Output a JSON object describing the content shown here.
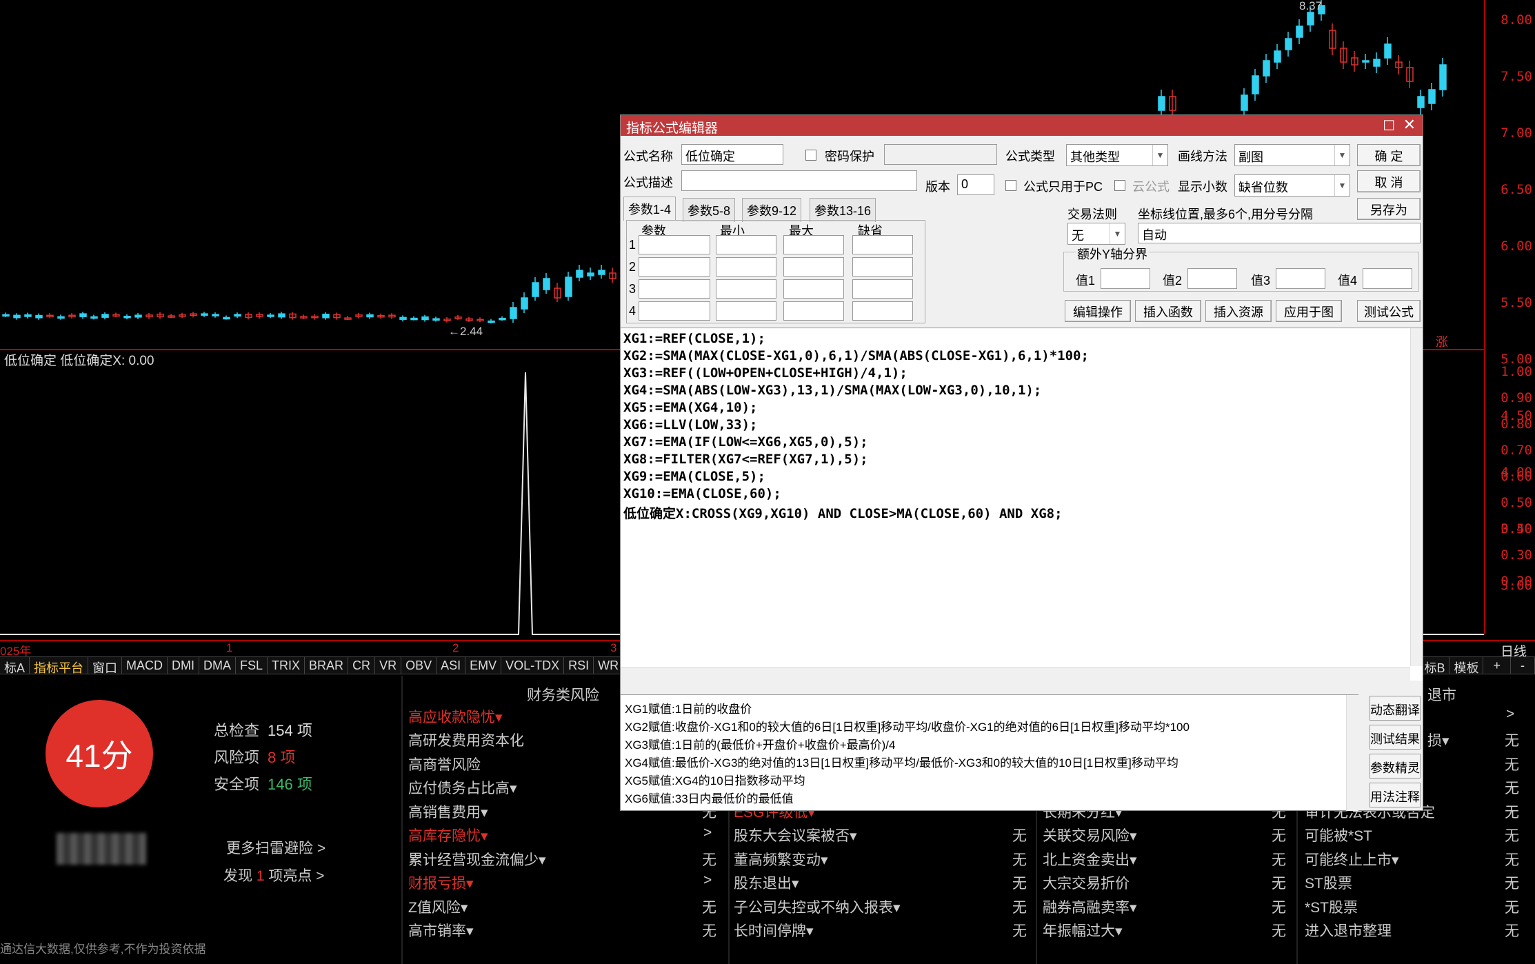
{
  "price_chart": {
    "high_label": "8.37",
    "low_label": "2.44",
    "y_ticks": [
      "8.00",
      "7.50",
      "7.00",
      "6.50",
      "6.00",
      "5.50",
      "5.00",
      "4.50",
      "4.00",
      "3.50",
      "3.00"
    ],
    "zhang_label": "涨"
  },
  "indicator": {
    "title": "低位确定  低位确定X: 0.00",
    "y_ticks": [
      "1.00",
      "0.90",
      "0.80",
      "0.70",
      "0.60",
      "0.50",
      "0.40",
      "0.30",
      "0.20"
    ]
  },
  "date_axis": {
    "labels": [
      "025年",
      "1",
      "2",
      "3"
    ],
    "period": "日线"
  },
  "tabs": [
    "标A",
    "指标平台",
    "窗口",
    "MACD",
    "DMI",
    "DMA",
    "FSL",
    "TRIX",
    "BRAR",
    "CR",
    "VR",
    "OBV",
    "ASI",
    "EMV",
    "VOL-TDX",
    "RSI",
    "WR"
  ],
  "tabs_right": [
    "标B",
    "模板",
    "+",
    "-"
  ],
  "risk": {
    "score": "41分",
    "total_label": "总检查",
    "total_value": "154 项",
    "risk_label": "风险项",
    "risk_value": "8 项",
    "safe_label": "安全项",
    "safe_value": "146 项",
    "more_scan": "更多扫雷避险 >",
    "found_prefix": "发现",
    "found_count": "1",
    "found_suffix": "项亮点 >",
    "disclaimer": "通达信大数据,仅供参考,不作为投资依据",
    "fin_title": "财务类风险",
    "col1": [
      "高应收款隐忧▾",
      "高研发费用资本化",
      "高商誉风险",
      "应付债务占比高▾",
      "高销售费用▾",
      "高库存隐忧▾",
      "累计经营现金流偏少▾",
      "财报亏损▾",
      "Z值风险▾",
      "高市销率▾"
    ],
    "col1_vals": [
      "",
      "",
      "",
      "",
      "无",
      ">",
      "无",
      ">",
      "无",
      "无"
    ],
    "col2": [
      "ESG评级低▾",
      "股东大会议案被否▾",
      "董高频繁变动▾",
      "股东退出▾",
      "子公司失控或不纳入报表▾",
      "长时间停牌▾"
    ],
    "col2_vals": [
      ">",
      "无",
      "无",
      "无",
      "无",
      "无"
    ],
    "col3": [
      "长期未分红▾",
      "关联交易风险▾",
      "北上资金卖出▾",
      "大宗交易折价",
      "融券高融卖率▾",
      "年振幅过大▾"
    ],
    "col3_vals": [
      "无",
      "无",
      "无",
      "无",
      "无",
      "无"
    ],
    "col4_title": "退市",
    "col4": [
      "审计无法表示或否定",
      "可能被*ST",
      "可能终止上市▾",
      "ST股票",
      "*ST股票",
      "进入退市整理"
    ],
    "col4_vals": [
      "无",
      "无",
      "无",
      "无",
      "无",
      "无"
    ],
    "col4_top_vals": [
      ">",
      "无",
      "无",
      "无"
    ],
    "col4_top": [
      "损▾"
    ]
  },
  "dialog": {
    "title": "指标公式编辑器",
    "name_label": "公式名称",
    "name_value": "低位确定",
    "password_label": "密码保护",
    "type_label": "公式类型",
    "type_value": "其他类型",
    "draw_label": "画线方法",
    "draw_value": "副图",
    "ok": "确  定",
    "cancel": "取  消",
    "save_as": "另存为",
    "desc_label": "公式描述",
    "version_label": "版本",
    "version_value": "0",
    "pc_only_label": "公式只用于PC",
    "cloud_label": "云公式",
    "decimals_label": "显示小数",
    "decimals_value": "缺省位数",
    "trade_rule_label": "交易法则",
    "trade_rule_value": "无",
    "coord_label": "坐标线位置,最多6个,用分号分隔",
    "coord_value": "自动",
    "extra_y_label": "额外Y轴分界",
    "val_labels": [
      "值1",
      "值2",
      "值3",
      "值4"
    ],
    "param_tabs": [
      "参数1-4",
      "参数5-8",
      "参数9-12",
      "参数13-16"
    ],
    "param_headers": [
      "参数",
      "最小",
      "最大",
      "缺省"
    ],
    "param_rows": [
      "1",
      "2",
      "3",
      "4"
    ],
    "buttons": [
      "编辑操作",
      "插入函数",
      "插入资源",
      "应用于图",
      "测试公式"
    ],
    "code": [
      "XG1:=REF(CLOSE,1);",
      "XG2:=SMA(MAX(CLOSE-XG1,0),6,1)/SMA(ABS(CLOSE-XG1),6,1)*100;",
      "XG3:=REF((LOW+OPEN+CLOSE+HIGH)/4,1);",
      "XG4:=SMA(ABS(LOW-XG3),13,1)/SMA(MAX(LOW-XG3,0),10,1);",
      "XG5:=EMA(XG4,10);",
      "XG6:=LLV(LOW,33);",
      "XG7:=EMA(IF(LOW<=XG6,XG5,0),5);",
      "XG8:=FILTER(XG7<=REF(XG7,1),5);",
      "XG9:=EMA(CLOSE,5);",
      "XG10:=EMA(CLOSE,60);",
      "低位确定X:CROSS(XG9,XG10) AND CLOSE>MA(CLOSE,60) AND XG8;"
    ],
    "explanations": [
      "XG1赋值:1日前的收盘价",
      "XG2赋值:收盘价-XG1和0的较大值的6日[1日权重]移动平均/收盘价-XG1的绝对值的6日[1日权重]移动平均*100",
      "XG3赋值:1日前的(最低价+开盘价+收盘价+最高价)/4",
      "XG4赋值:最低价-XG3的绝对值的13日[1日权重]移动平均/最低价-XG3和0的较大值的10日[1日权重]移动平均",
      "XG5赋值:XG4的10日指数移动平均",
      "XG6赋值:33日内最低价的最低值"
    ],
    "side_buttons": [
      "动态翻译",
      "测试结果",
      "参数精灵",
      "用法注释"
    ]
  },
  "colors": {
    "up": "#e03030",
    "down": "#30d0f0",
    "title_bar": "#c03a3c",
    "score": "#e0302a"
  }
}
